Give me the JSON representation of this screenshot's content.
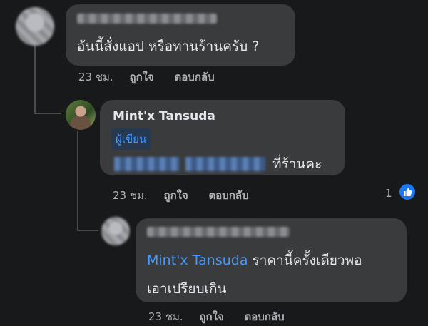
{
  "comments": [
    {
      "text": "อันนี้สั่งแอป หรือทานร้านครับ ?",
      "time": "23 ชม.",
      "like_label": "ถูกใจ",
      "reply_label": "ตอบกลับ"
    },
    {
      "author": "Mint'x Tansuda",
      "badge": "ผู้เขียน",
      "text_suffix": "ที่ร้านคะ",
      "time": "23 ชม.",
      "like_label": "ถูกใจ",
      "reply_label": "ตอบกลับ",
      "like_count": "1",
      "reaction_color": "#1877f2"
    },
    {
      "mention": "Mint'x Tansuda",
      "text_line1": "ราคานี้ครั้งเดียวพอ",
      "text_line2": "เอาเปรียบเกิน",
      "time": "23 ชม.",
      "like_label": "ถูกใจ",
      "reply_label": "ตอบกลับ"
    }
  ],
  "colors": {
    "background": "#18191a",
    "bubble": "#3a3b3c",
    "link": "#4599ff",
    "meta": "#b0b3b8"
  },
  "icons": [
    "avatar",
    "thumbs-up-icon"
  ]
}
